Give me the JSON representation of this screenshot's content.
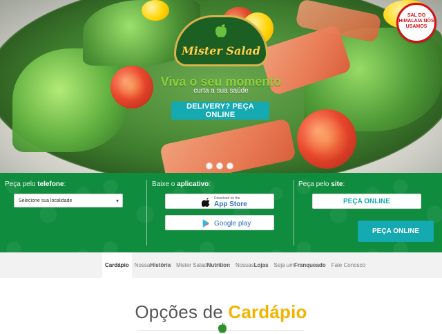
{
  "hero": {
    "brand": "Mister Salad",
    "headline": "Viva o seu momento",
    "subline": "curta a sua saúde",
    "cta_label": "DELIVERY? PEÇA ONLINE",
    "badge_text": "SAL DO HIMALAIA NÓS USAMOS"
  },
  "band": {
    "col1": {
      "prefix": "Peça pelo",
      "emph": "telefone",
      "suffix": ":",
      "select_placeholder": "Selecione sua localidade"
    },
    "col2": {
      "prefix": "Baixe o",
      "emph": "aplicativo",
      "suffix": ":",
      "appstore_small": "Download on the",
      "appstore_big": "App Store",
      "google_play": "Google play"
    },
    "col3": {
      "prefix": "Peça pelo",
      "emph": "site",
      "suffix": ":",
      "button1": "PEÇA ONLINE",
      "button2": "PEÇA ONLINE"
    }
  },
  "nav": {
    "items": [
      {
        "label_a": "Cardápio",
        "label_b": ""
      },
      {
        "label_a": "Nossa ",
        "label_b": "História"
      },
      {
        "label_a": "Mister Salad ",
        "label_b": "Nutrition"
      },
      {
        "label_a": "Nossas ",
        "label_b": "Lojas"
      },
      {
        "label_a": "Seja um ",
        "label_b": "Franqueado"
      },
      {
        "label_a": "Fale Conosco",
        "label_b": ""
      }
    ]
  },
  "section": {
    "title_a": "Opções de ",
    "title_b": "Cardápio"
  },
  "colors": {
    "green": "#0f8c3e",
    "teal": "#15a9b2",
    "accent_yellow": "#f2b400"
  }
}
